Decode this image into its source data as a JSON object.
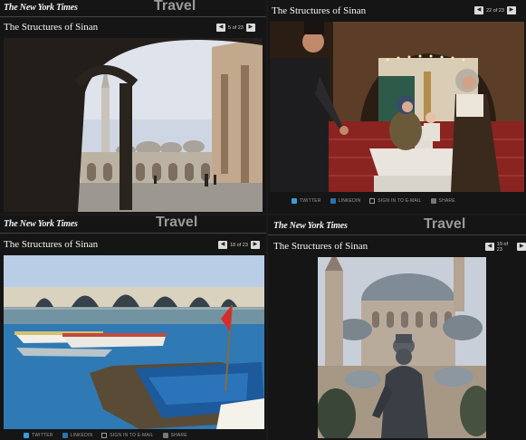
{
  "panels": [
    {
      "logo": "The New York Times",
      "section": "Travel",
      "title": "The Structures of Sinan",
      "prev": "◀",
      "next": "▶",
      "counter": "5 of 23",
      "photo_alt": "Mosque courtyard with arcades and minaret"
    },
    {
      "title": "The Structures of Sinan",
      "prev": "◀",
      "next": "▶",
      "counter": "22 of 23",
      "photo_alt": "Family at ablution fountain inside mosque",
      "share": [
        "TWITTER",
        "LINKEDIN",
        "SIGN IN TO E-MAIL",
        "SHARE"
      ]
    },
    {
      "logo": "The New York Times",
      "section": "Travel",
      "title": "The Structures of Sinan",
      "prev": "◀",
      "next": "▶",
      "counter": "18 of 23",
      "photo_alt": "Arched stone bridge over water with boats",
      "share": [
        "TWITTER",
        "LINKEDIN",
        "SIGN IN TO E-MAIL",
        "SHARE"
      ]
    },
    {
      "logo": "The New York Times",
      "section": "Travel",
      "title": "The Structures of Sinan",
      "prev": "◀",
      "next": "▶",
      "counter": "19 of 23",
      "photo_alt": "Statue of Sinan in front of domed mosque"
    }
  ],
  "colors": {
    "background": "#151515",
    "logo": "#f2f2f2",
    "section": "#9a9a9a",
    "twitter": "#3b9ad9",
    "linkedin": "#2a73b3"
  },
  "icons": [
    "prev-arrow-icon",
    "next-arrow-icon",
    "twitter-icon",
    "linkedin-icon",
    "email-icon",
    "share-icon"
  ]
}
